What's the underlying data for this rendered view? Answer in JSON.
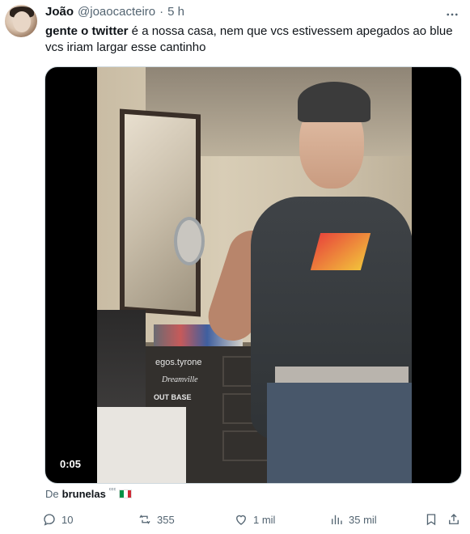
{
  "author": {
    "name": "João",
    "handle": "@joaocacteiro",
    "separator": "·",
    "time": "5 h"
  },
  "tweet": {
    "bold_text": "gente o twitter",
    "text": " é a nossa casa, nem que vcs estivessem apegados ao blue vcs iriam largar esse cantinho"
  },
  "media": {
    "type": "video",
    "duration": "0:05",
    "overlay_texts": [
      "egos.tyrone",
      "Dreamville",
      "OUT BASE"
    ]
  },
  "attribution": {
    "prefix": "De",
    "user": "brunelas",
    "superscript": "ᶜᶜᶜ",
    "flag": "italy-flag-icon",
    "flag_colors": [
      "#009246",
      "#ffffff",
      "#ce2b37"
    ]
  },
  "actions": {
    "replies": "10",
    "reposts": "355",
    "likes": "1 mil",
    "views": "35 mil"
  },
  "colors": {
    "text": "#0f1419",
    "secondary": "#536471",
    "media_bg": "#000000"
  }
}
